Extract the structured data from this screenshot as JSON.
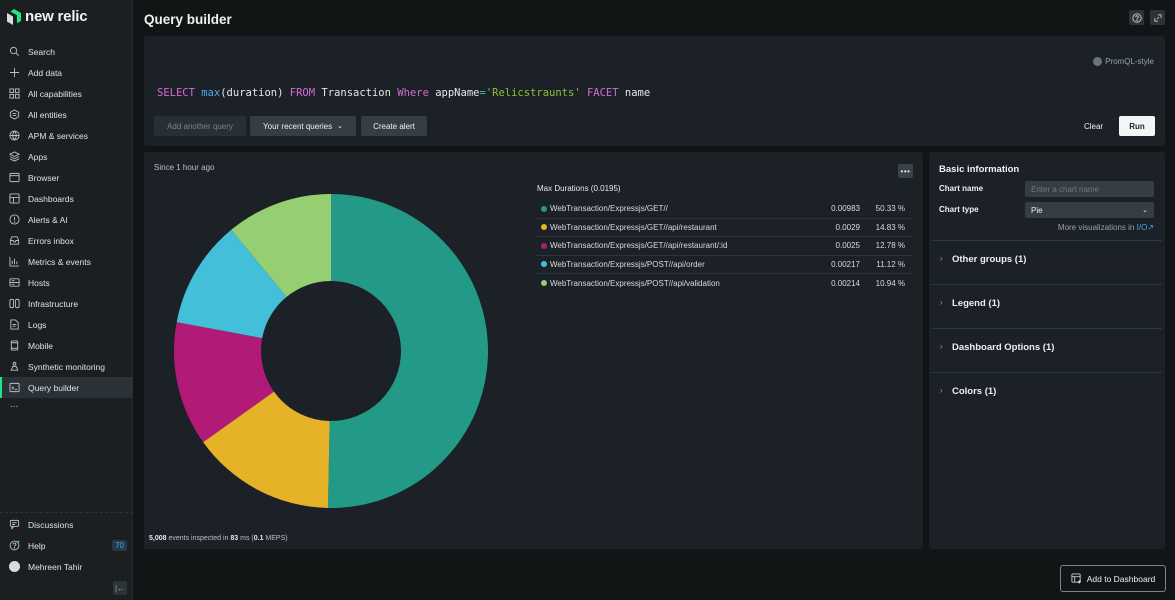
{
  "brand": {
    "name": "new relic",
    "logo_color": "#1ce783"
  },
  "sidebar": {
    "items": [
      {
        "label": "Search",
        "icon": "search-icon"
      },
      {
        "label": "Add data",
        "icon": "plus-icon"
      },
      {
        "label": "All capabilities",
        "icon": "grid-icon"
      },
      {
        "label": "All entities",
        "icon": "entities-icon"
      },
      {
        "label": "APM & services",
        "icon": "globe-icon"
      },
      {
        "label": "Apps",
        "icon": "layers-icon"
      },
      {
        "label": "Browser",
        "icon": "browser-icon"
      },
      {
        "label": "Dashboards",
        "icon": "dashboard-icon"
      },
      {
        "label": "Alerts & AI",
        "icon": "alert-icon"
      },
      {
        "label": "Errors inbox",
        "icon": "inbox-icon"
      },
      {
        "label": "Metrics & events",
        "icon": "bar-chart-icon"
      },
      {
        "label": "Hosts",
        "icon": "server-icon"
      },
      {
        "label": "Infrastructure",
        "icon": "infrastructure-icon"
      },
      {
        "label": "Logs",
        "icon": "document-icon"
      },
      {
        "label": "Mobile",
        "icon": "mobile-icon"
      },
      {
        "label": "Synthetic monitoring",
        "icon": "robot-icon"
      },
      {
        "label": "Query builder",
        "icon": "terminal-icon",
        "active": true
      }
    ],
    "more_label": "...",
    "bottom": {
      "discussions": "Discussions",
      "help": "Help",
      "help_badge": "70",
      "user": "Mehreen Tahir"
    }
  },
  "header": {
    "title": "Query builder"
  },
  "query": {
    "promql_label": "PromQL-style",
    "tokens": {
      "select": "SELECT",
      "fn": "max",
      "args": "(duration)",
      "from": "FROM",
      "table": "Transaction",
      "where": "Where",
      "attr": "appName",
      "op": "=",
      "value": "'Relicstraunts'",
      "facet": "FACET",
      "facet_attr": "name"
    },
    "buttons": {
      "add_query": "Add another query",
      "recent": "Your recent queries",
      "alert": "Create alert",
      "clear": "Clear",
      "run": "Run"
    }
  },
  "chart_panel": {
    "since": "Since 1 hour ago",
    "footer": {
      "events": "5,008",
      "mid": "events inspected in",
      "ms": "83",
      "ms_label": "ms (",
      "meps": "0.1",
      "meps_label": "MEPS)"
    }
  },
  "chart_data": {
    "type": "pie",
    "variant": "donut",
    "title": "Max Durations (0.0195)",
    "total": 0.0195,
    "slices": [
      {
        "label": "WebTransaction/Expressjs/GET//",
        "value": 0.00983,
        "percent": "50.33 %",
        "pct": 50.33,
        "color": "#229a87"
      },
      {
        "label": "WebTransaction/Expressjs/GET//api/restaurant",
        "value": 0.0029,
        "percent": "14.83 %",
        "pct": 14.83,
        "color": "#e6b227"
      },
      {
        "label": "WebTransaction/Expressjs/GET//api/restaurant/:id",
        "value": 0.0025,
        "percent": "12.78 %",
        "pct": 12.78,
        "color": "#b21a78"
      },
      {
        "label": "WebTransaction/Expressjs/POST//api/order",
        "value": 0.00217,
        "percent": "11.12 %",
        "pct": 11.12,
        "color": "#43bfda"
      },
      {
        "label": "WebTransaction/Expressjs/POST//api/validation",
        "value": 0.00214,
        "percent": "10.94 %",
        "pct": 10.94,
        "color": "#96cf71"
      }
    ],
    "legend_position": "right"
  },
  "settings": {
    "title": "Basic information",
    "chart_name_label": "Chart name",
    "chart_name_placeholder": "Enter a chart name",
    "chart_type_label": "Chart type",
    "chart_type_value": "Pie",
    "more_viz": "More visualizations in",
    "more_viz_link": "I/O",
    "sections": [
      "Other groups (1)",
      "Legend (1)",
      "Dashboard Options (1)",
      "Colors (1)"
    ]
  },
  "add_to_dashboard": "Add to Dashboard"
}
